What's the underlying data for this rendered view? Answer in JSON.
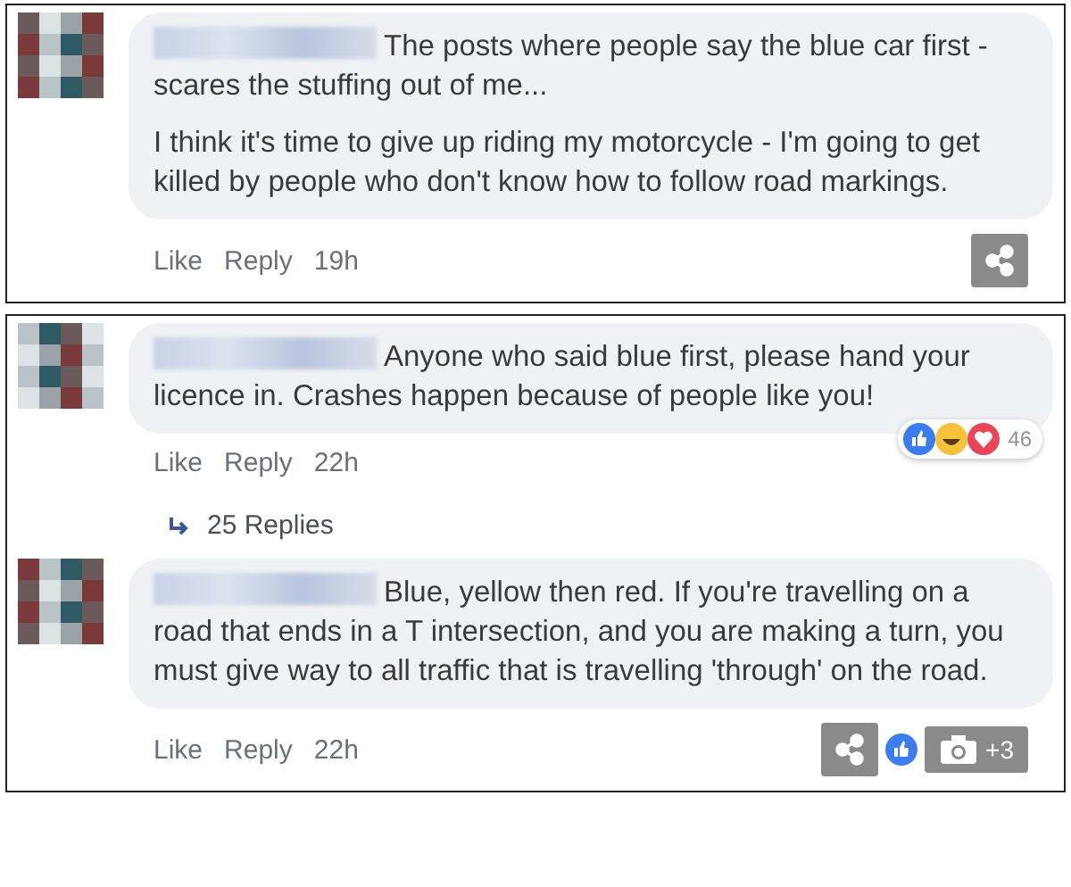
{
  "panels": [
    {
      "comments": [
        {
          "paragraphs": [
            "The posts where people say the blue car first - scares the stuffing out of me...",
            "I think it's time to give up riding my motorcycle - I'm going to get killed by people who don't know how to follow road markings."
          ],
          "actions": [
            "Like",
            "Reply"
          ],
          "time": "19h",
          "share_button": true
        }
      ]
    },
    {
      "comments": [
        {
          "paragraphs": [
            "Anyone who said blue first, please hand your licence in. Crashes happen because of people like you!"
          ],
          "actions": [
            "Like",
            "Reply"
          ],
          "time": "22h",
          "reaction_count": "46",
          "replies": "25 Replies"
        },
        {
          "paragraphs": [
            "Blue, yellow then red. If you're travelling on a road that ends in a T intersection, and you are making a turn, you must give way to all traffic that is travelling 'through' on the road."
          ],
          "actions": [
            "Like",
            "Reply"
          ],
          "time": "22h",
          "share_button": true,
          "photo_count": "+3"
        }
      ]
    }
  ]
}
